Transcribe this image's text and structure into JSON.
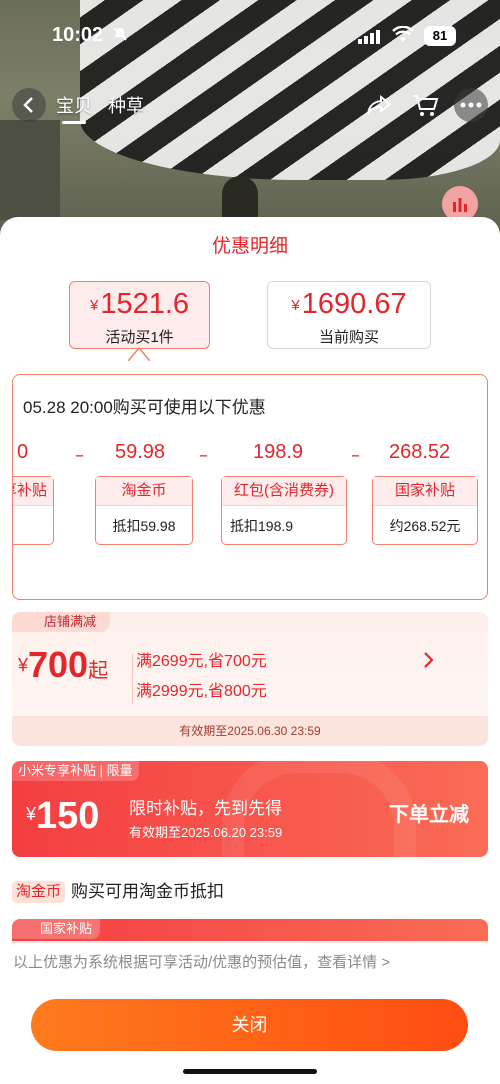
{
  "status_bar": {
    "time": "10:02",
    "battery": "81"
  },
  "nav": {
    "tabs": [
      "宝贝",
      "种草"
    ]
  },
  "sheet": {
    "title": "优惠明细",
    "price_options": [
      {
        "currency": "¥",
        "price": "1521.6",
        "label": "活动买1件",
        "active": true
      },
      {
        "currency": "¥",
        "price": "1690.67",
        "label": "当前购买",
        "active": false
      }
    ],
    "detail": {
      "heading": "05.28 20:00购买可使用以下优惠",
      "partial_value": "0",
      "partial_label": "享补贴",
      "minus": "–",
      "items": [
        {
          "value": "59.98",
          "title": "淘金币",
          "sub": "抵扣59.98"
        },
        {
          "value": "198.9",
          "title": "红包(含消费券)",
          "sub": "抵扣198.9"
        },
        {
          "value": "268.52",
          "title": "国家补贴",
          "sub": "约268.52元"
        }
      ]
    },
    "shop_discount": {
      "tag": "店铺满减",
      "currency": "¥",
      "amount": "700",
      "qi": "起",
      "rules": [
        "满2699元,省700元",
        "满2999元,省800元"
      ],
      "validity": "有效期至2025.06.30 23:59"
    },
    "xiaomi": {
      "tag": "小米专享补贴 | 限量",
      "currency": "¥",
      "amount": "150",
      "line1": "限时补贴，先到先得",
      "line2": "有效期至2025.06.20 23:59",
      "action": "下单立减"
    },
    "taojinbi": {
      "tag": "淘金币",
      "text": "购买可用淘金币抵扣"
    },
    "national": {
      "tag": "国家补贴"
    },
    "note": "以上优惠为系统根据可享活动/优惠的预估值，查看详情 >",
    "close": "关闭"
  },
  "colors": {
    "accent_red": "#e3262b",
    "button_orange": "#ff5a14"
  }
}
